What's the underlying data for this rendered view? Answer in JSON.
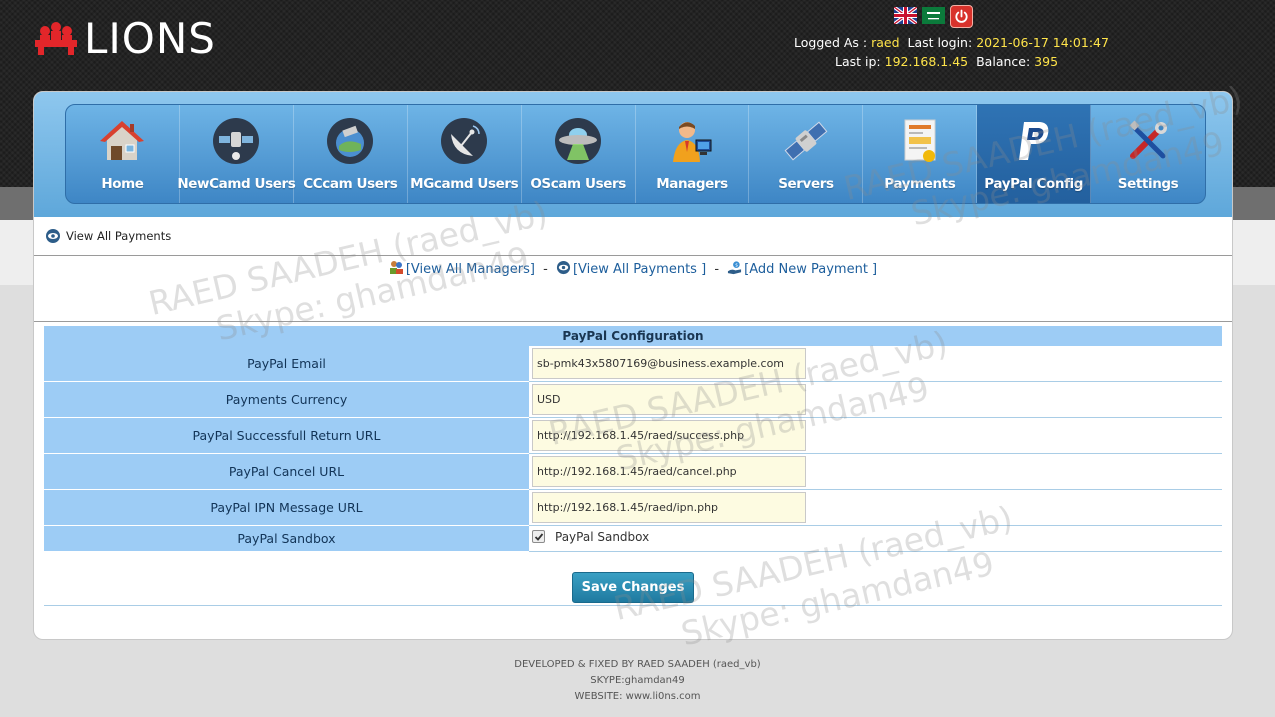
{
  "app": {
    "logo_text": "LIONS"
  },
  "header": {
    "logged_as_label": "Logged As :",
    "user": "raed",
    "last_login_label": "Last login:",
    "last_login": "2021-06-17 14:01:47",
    "last_ip_label": "Last ip:",
    "last_ip": "192.168.1.45",
    "balance_label": "Balance:",
    "balance": "395",
    "flags": [
      "english-flag-icon",
      "arabic-flag-icon"
    ],
    "logout_icon": "power-icon"
  },
  "nav": [
    {
      "label": "Home",
      "icon": "home-icon"
    },
    {
      "label": "NewCamd Users",
      "icon": "satellite-icon"
    },
    {
      "label": "CCcam Users",
      "icon": "satellite-globe-icon"
    },
    {
      "label": "MGcamd Users",
      "icon": "dish-icon"
    },
    {
      "label": "OScam Users",
      "icon": "ufo-icon"
    },
    {
      "label": "Managers",
      "icon": "manager-icon"
    },
    {
      "label": "Servers",
      "icon": "server-satellite-icon"
    },
    {
      "label": "Payments",
      "icon": "invoice-icon"
    },
    {
      "label": "PayPal Config",
      "icon": "paypal-icon",
      "active": true
    },
    {
      "label": "Settings",
      "icon": "tools-icon"
    }
  ],
  "breadcrumb": {
    "label": "View All Payments"
  },
  "links": {
    "view_managers": "[View All Managers]",
    "view_payments": "[View All Payments ]",
    "add_payment": "[Add New Payment ]",
    "sep": "-"
  },
  "form": {
    "title": "PayPal Configuration",
    "fields": [
      {
        "label": "PayPal Email",
        "value": "sb-pmk43x5807169@business.example.com"
      },
      {
        "label": "Payments Currency",
        "value": "USD"
      },
      {
        "label": "PayPal Successfull Return URL",
        "value": "http://192.168.1.45/raed/success.php"
      },
      {
        "label": "PayPal Cancel URL",
        "value": "http://192.168.1.45/raed/cancel.php"
      },
      {
        "label": "PayPal IPN Message URL",
        "value": "http://192.168.1.45/raed/ipn.php"
      }
    ],
    "sandbox": {
      "label": "PayPal Sandbox",
      "checkbox_label": "PayPal Sandbox",
      "checked": true
    },
    "save_label": "Save Changes"
  },
  "footer": {
    "line1": "DEVELOPED & FIXED BY RAED SAADEH (raed_vb)",
    "line2": "SKYPE:ghamdan49",
    "line3": "WEBSITE: www.li0ns.com"
  },
  "watermark": {
    "line1": "RAED SAADEH (raed_vb)",
    "line2": "Skype: ghamdan49"
  },
  "colors": {
    "nav_blue": "#3e86c5",
    "header_dark": "#1c1c1c",
    "highlight_yellow": "#ffe44a",
    "label_blue": "#9dccf5",
    "input_bg": "#fdfbe1",
    "button_teal": "#1f7aa0"
  }
}
